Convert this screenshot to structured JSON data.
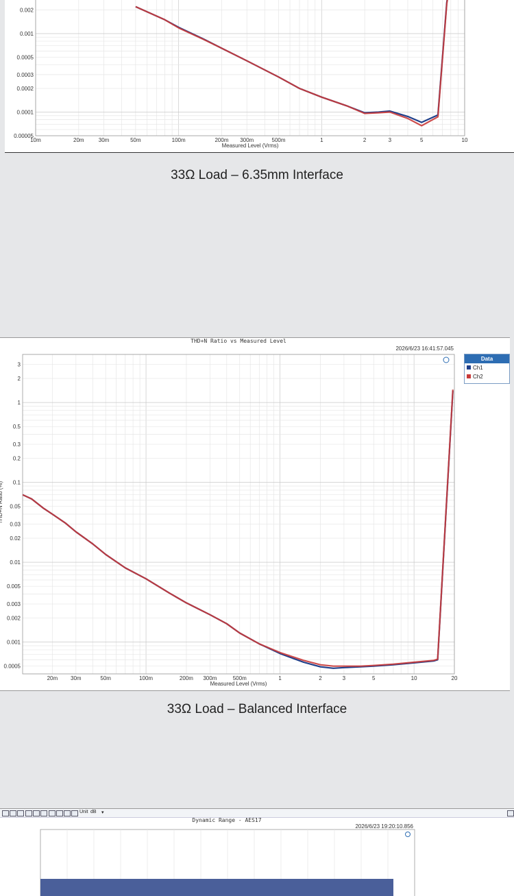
{
  "captions": {
    "first": "33Ω Load – 6.35mm Interface",
    "second": "33Ω Load – Balanced Interface"
  },
  "toolbar": {
    "unit_label": "Unit",
    "unit_value": "dB"
  },
  "colors": {
    "ch1": "#2b4a8c",
    "ch2": "#c83a3a",
    "legend_header": "#2d6db3",
    "bar": "#4a5f9a"
  },
  "chart_data": [
    {
      "type": "line",
      "title": "",
      "xlabel": "Measured Level (Vrms)",
      "ylabel": "",
      "xscale": "log",
      "yscale": "log",
      "xlim": [
        0.01,
        10
      ],
      "ylim_visible": [
        5e-05,
        0.0025
      ],
      "grid": true,
      "xticks": [
        "10m",
        "20m",
        "30m",
        "50m",
        "100m",
        "200m",
        "300m",
        "500m",
        "1",
        "2",
        "3",
        "5",
        "10"
      ],
      "yticks": [
        "0.002",
        "0.001",
        "0.0005",
        "0.0003",
        "0.0002",
        "0.0001",
        "0.00005"
      ],
      "series": [
        {
          "name": "Ch1",
          "x": [
            0.05,
            0.08,
            0.1,
            0.15,
            0.2,
            0.3,
            0.5,
            0.7,
            1,
            1.5,
            2,
            2.5,
            3,
            4,
            5,
            6.5,
            7.5,
            8.5
          ],
          "y": [
            0.0022,
            0.0015,
            0.0012,
            0.00085,
            0.00065,
            0.00045,
            0.00028,
            0.0002,
            0.000155,
            0.00012,
            9.8e-05,
            0.0001,
            0.000103,
            8.8e-05,
            7.4e-05,
            9.2e-05,
            0.0025,
            0.01
          ]
        },
        {
          "name": "Ch2",
          "x": [
            0.05,
            0.08,
            0.1,
            0.15,
            0.2,
            0.3,
            0.5,
            0.7,
            1,
            1.5,
            2,
            2.5,
            3,
            4,
            5,
            6.5,
            7.5,
            8.5
          ],
          "y": [
            0.0022,
            0.0015,
            0.00118,
            0.00084,
            0.00065,
            0.00045,
            0.00028,
            0.0002,
            0.000155,
            0.00012,
            9.6e-05,
            9.8e-05,
            0.0001,
            8.3e-05,
            6.7e-05,
            8.7e-05,
            0.0024,
            0.01
          ]
        }
      ]
    },
    {
      "type": "line",
      "title": "THD+N Ratio vs Measured Level",
      "timestamp": "2026/6/23 16:41:57.045",
      "xlabel": "Measured Level (Vrms)",
      "ylabel": "THD+N Ratio (%)",
      "xscale": "log",
      "yscale": "log",
      "xlim": [
        0.012,
        20
      ],
      "ylim": [
        0.0004,
        4
      ],
      "grid": true,
      "legend": {
        "title": "Data",
        "entries": [
          "Ch1",
          "Ch2"
        ],
        "position": "right"
      },
      "xticks": [
        "20m",
        "30m",
        "50m",
        "100m",
        "200m",
        "300m",
        "500m",
        "1",
        "2",
        "3",
        "5",
        "10",
        "20"
      ],
      "yticks": [
        "3",
        "2",
        "1",
        "0.5",
        "0.3",
        "0.2",
        "0.1",
        "0.05",
        "0.03",
        "0.02",
        "0.01",
        "0.005",
        "0.003",
        "0.002",
        "0.001",
        "0.0005"
      ],
      "series": [
        {
          "name": "Ch1",
          "x": [
            0.012,
            0.014,
            0.017,
            0.02,
            0.025,
            0.03,
            0.04,
            0.05,
            0.07,
            0.1,
            0.15,
            0.2,
            0.3,
            0.4,
            0.5,
            0.7,
            1,
            1.5,
            2,
            2.5,
            3,
            4,
            5,
            7,
            10,
            14,
            15,
            19.5
          ],
          "y": [
            0.07,
            0.062,
            0.048,
            0.04,
            0.031,
            0.024,
            0.017,
            0.0125,
            0.0085,
            0.0062,
            0.0041,
            0.0031,
            0.0022,
            0.0017,
            0.0013,
            0.00095,
            0.00072,
            0.00056,
            0.00049,
            0.00047,
            0.00048,
            0.00049,
            0.0005,
            0.00052,
            0.00055,
            0.00058,
            0.0006,
            1.4
          ]
        },
        {
          "name": "Ch2",
          "x": [
            0.012,
            0.014,
            0.017,
            0.02,
            0.025,
            0.03,
            0.04,
            0.05,
            0.07,
            0.1,
            0.15,
            0.2,
            0.3,
            0.4,
            0.5,
            0.7,
            1,
            1.5,
            2,
            2.5,
            3,
            4,
            5,
            7,
            10,
            14,
            15,
            19.5
          ],
          "y": [
            0.07,
            0.062,
            0.048,
            0.04,
            0.031,
            0.024,
            0.017,
            0.0125,
            0.0085,
            0.0062,
            0.0041,
            0.0031,
            0.0022,
            0.0017,
            0.0013,
            0.00095,
            0.00074,
            0.00059,
            0.00052,
            0.0005,
            0.0005,
            0.0005,
            0.00051,
            0.00053,
            0.00056,
            0.00059,
            0.00061,
            1.45
          ]
        }
      ]
    },
    {
      "type": "bar",
      "title": "Dynamic Range - AES17",
      "timestamp": "2026/6/23 19:20:10.856"
    }
  ]
}
